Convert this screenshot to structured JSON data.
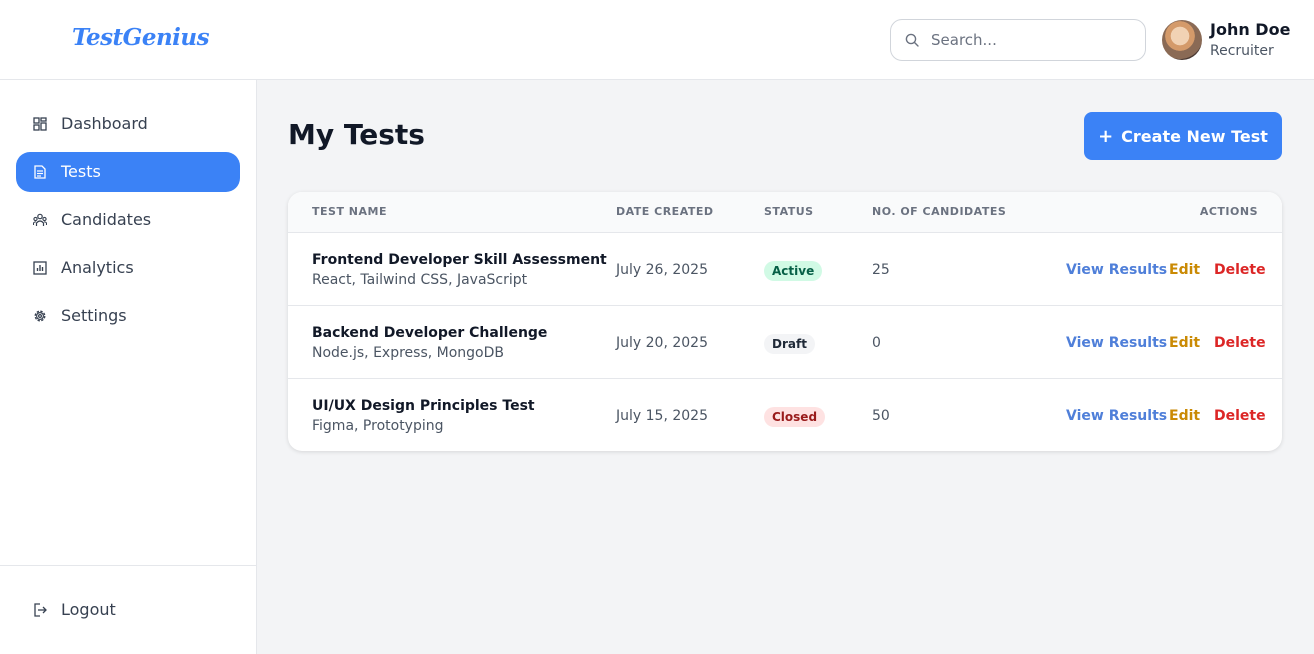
{
  "header": {
    "logo": "TestGenius",
    "search_placeholder": "Search...",
    "user": {
      "name": "John Doe",
      "role": "Recruiter"
    }
  },
  "sidebar": {
    "items": [
      {
        "label": "Dashboard",
        "icon": "dashboard-icon",
        "active": false
      },
      {
        "label": "Tests",
        "icon": "document-icon",
        "active": true
      },
      {
        "label": "Candidates",
        "icon": "users-icon",
        "active": false
      },
      {
        "label": "Analytics",
        "icon": "chart-icon",
        "active": false
      },
      {
        "label": "Settings",
        "icon": "gear-icon",
        "active": false
      }
    ],
    "logout": {
      "label": "Logout",
      "icon": "logout-icon"
    }
  },
  "main": {
    "title": "My Tests",
    "create_button": "Create New Test",
    "table": {
      "columns": [
        "TEST NAME",
        "DATE CREATED",
        "STATUS",
        "NO. OF CANDIDATES",
        "ACTIONS"
      ],
      "rows": [
        {
          "name": "Frontend Developer Skill Assessment",
          "skills": "React, Tailwind CSS, JavaScript",
          "date": "July 26, 2025",
          "status": "Active",
          "candidates": "25"
        },
        {
          "name": "Backend Developer Challenge",
          "skills": "Node.js, Express, MongoDB",
          "date": "July 20, 2025",
          "status": "Draft",
          "candidates": "0"
        },
        {
          "name": "UI/UX Design Principles Test",
          "skills": "Figma, Prototyping",
          "date": "July 15, 2025",
          "status": "Closed",
          "candidates": "50"
        }
      ],
      "actions": {
        "view": "View Results",
        "edit": "Edit",
        "delete": "Delete"
      }
    }
  },
  "colors": {
    "accent": "#3b82f6",
    "active_badge": "#d1fae5",
    "draft_badge": "#f3f4f6",
    "closed_badge": "#fee2e2",
    "edit_link": "#ca8a04",
    "delete_link": "#dc2626"
  }
}
